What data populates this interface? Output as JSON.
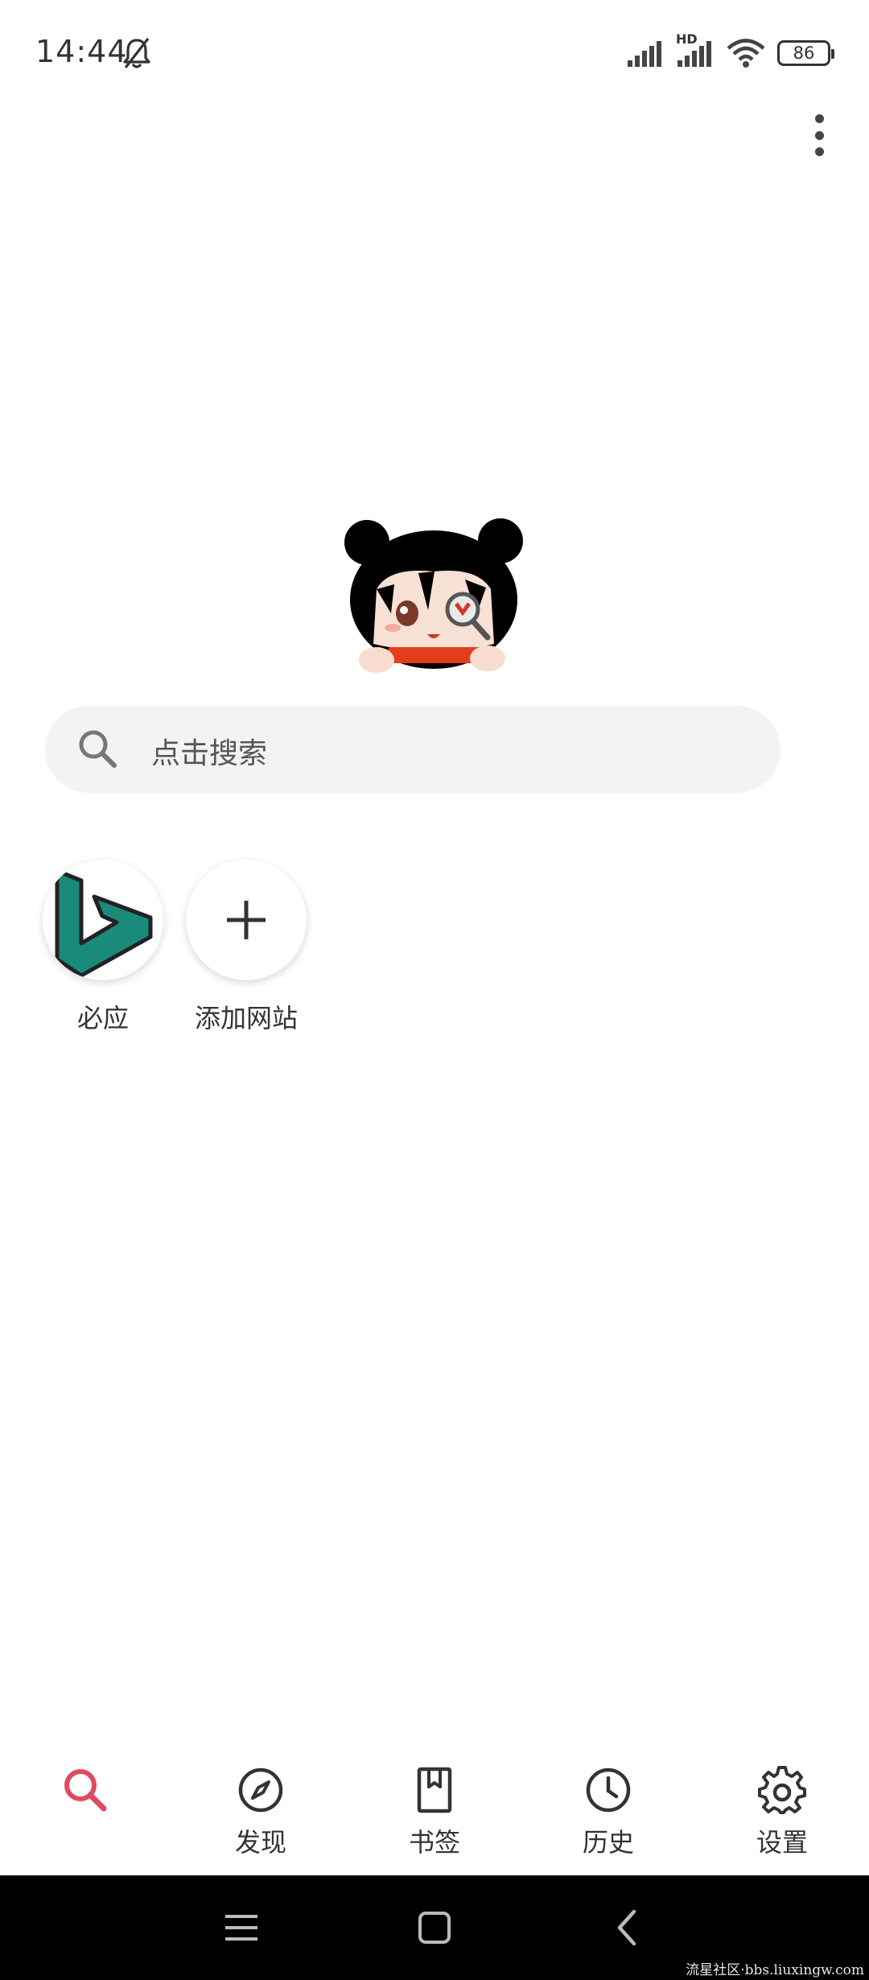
{
  "status_bar": {
    "time": "14:44",
    "network_label": "HD",
    "battery": "86"
  },
  "search": {
    "placeholder": "点击搜索"
  },
  "shortcuts": [
    {
      "label": "必应",
      "icon": "bing-logo-icon"
    },
    {
      "label": "添加网站",
      "icon": "plus-icon"
    }
  ],
  "bottom_nav": {
    "items": [
      {
        "label": "",
        "icon": "search-icon",
        "active": true
      },
      {
        "label": "发现",
        "icon": "compass-icon"
      },
      {
        "label": "书签",
        "icon": "bookmark-icon"
      },
      {
        "label": "历史",
        "icon": "clock-icon"
      },
      {
        "label": "设置",
        "icon": "gear-icon"
      }
    ]
  },
  "watermark": "流星社区·bbs.liuxingw.com",
  "colors": {
    "accent": "#e04a5f",
    "bing": "#1a8a7a",
    "search_bar_bg": "#f3f3f3",
    "system_nav_bg": "#000000"
  }
}
